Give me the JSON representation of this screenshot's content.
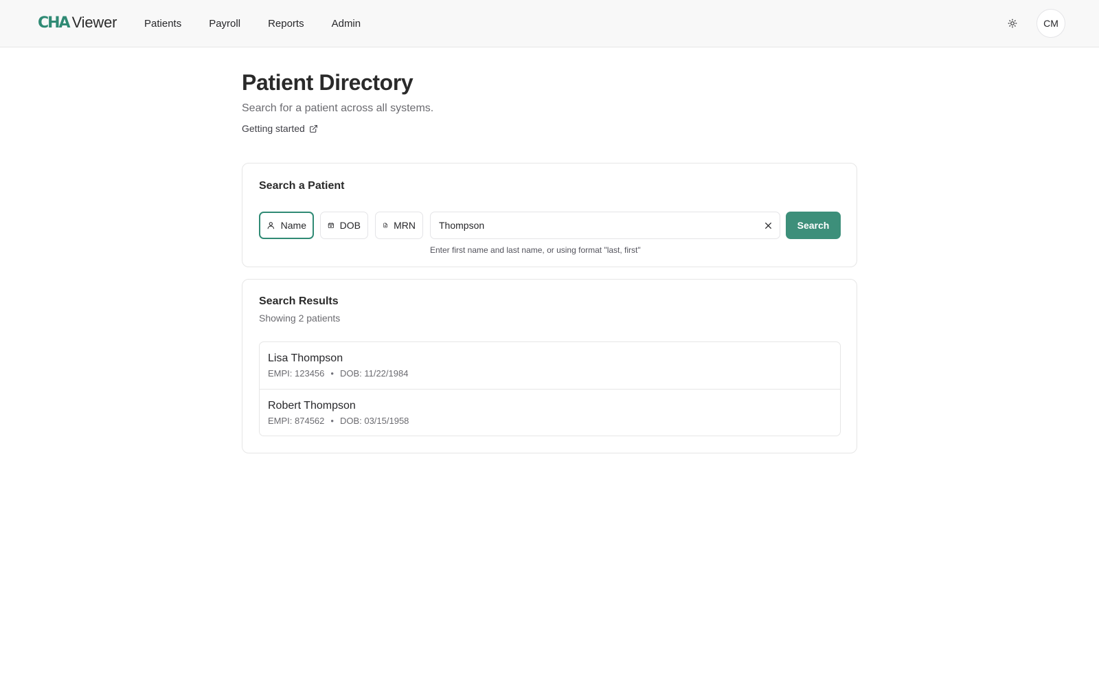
{
  "app": {
    "logo_mark": "CHA",
    "logo_word": "Viewer",
    "brand_color": "#2f8a74",
    "user_initials": "CM"
  },
  "nav": {
    "items": [
      {
        "label": "Patients"
      },
      {
        "label": "Payroll"
      },
      {
        "label": "Reports"
      },
      {
        "label": "Admin"
      }
    ]
  },
  "header_icons": {
    "theme_toggle": "sun-icon"
  },
  "page": {
    "title": "Patient Directory",
    "subtitle": "Search for a patient across all systems.",
    "getting_started": "Getting started",
    "getting_started_icon": "external-link-icon"
  },
  "search": {
    "title": "Search a Patient",
    "modes": [
      {
        "label": "Name",
        "icon": "user-icon",
        "active": true
      },
      {
        "label": "DOB",
        "icon": "calendar-icon",
        "active": false
      },
      {
        "label": "MRN",
        "icon": "document-icon",
        "active": false
      }
    ],
    "value": "Thompson",
    "hint": "Enter first name and last name, or using format \"last, first\"",
    "button_label": "Search",
    "button_color": "#3d8f7a"
  },
  "results": {
    "title": "Search Results",
    "count_text": "Showing 2 patients",
    "items": [
      {
        "name": "Lisa Thompson",
        "empi": "EMPI: 123456",
        "separator": "•",
        "dob": "DOB: 11/22/1984"
      },
      {
        "name": "Robert Thompson",
        "empi": "EMPI: 874562",
        "separator": "•",
        "dob": "DOB: 03/15/1958"
      }
    ]
  }
}
